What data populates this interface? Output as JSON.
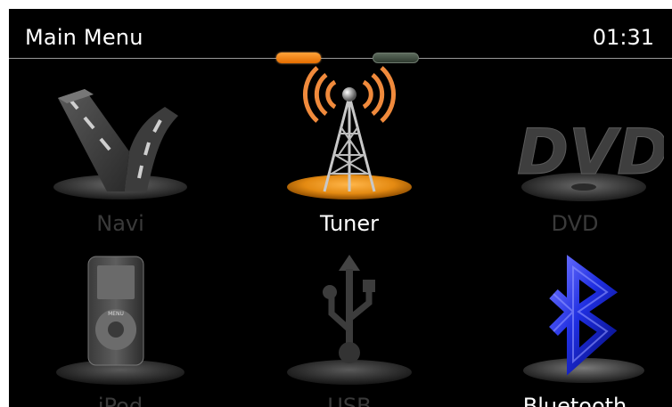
{
  "header": {
    "title": "Main Menu",
    "clock": "01:31",
    "page_indicator": {
      "pages": 2,
      "current": 1,
      "active_color": "#f08a1c",
      "inactive_color": "#4a564b"
    }
  },
  "menu": {
    "items": [
      {
        "label": "Navi",
        "icon": "road-icon",
        "state": "inactive"
      },
      {
        "label": "Tuner",
        "icon": "radio-tower-icon",
        "state": "active"
      },
      {
        "label": "DVD",
        "icon": "dvd-icon",
        "state": "inactive"
      },
      {
        "label": "iPod",
        "icon": "ipod-icon",
        "state": "inactive"
      },
      {
        "label": "USB",
        "icon": "usb-icon",
        "state": "inactive"
      },
      {
        "label": "Bluetooth",
        "icon": "bluetooth-icon",
        "state": "active"
      }
    ]
  }
}
